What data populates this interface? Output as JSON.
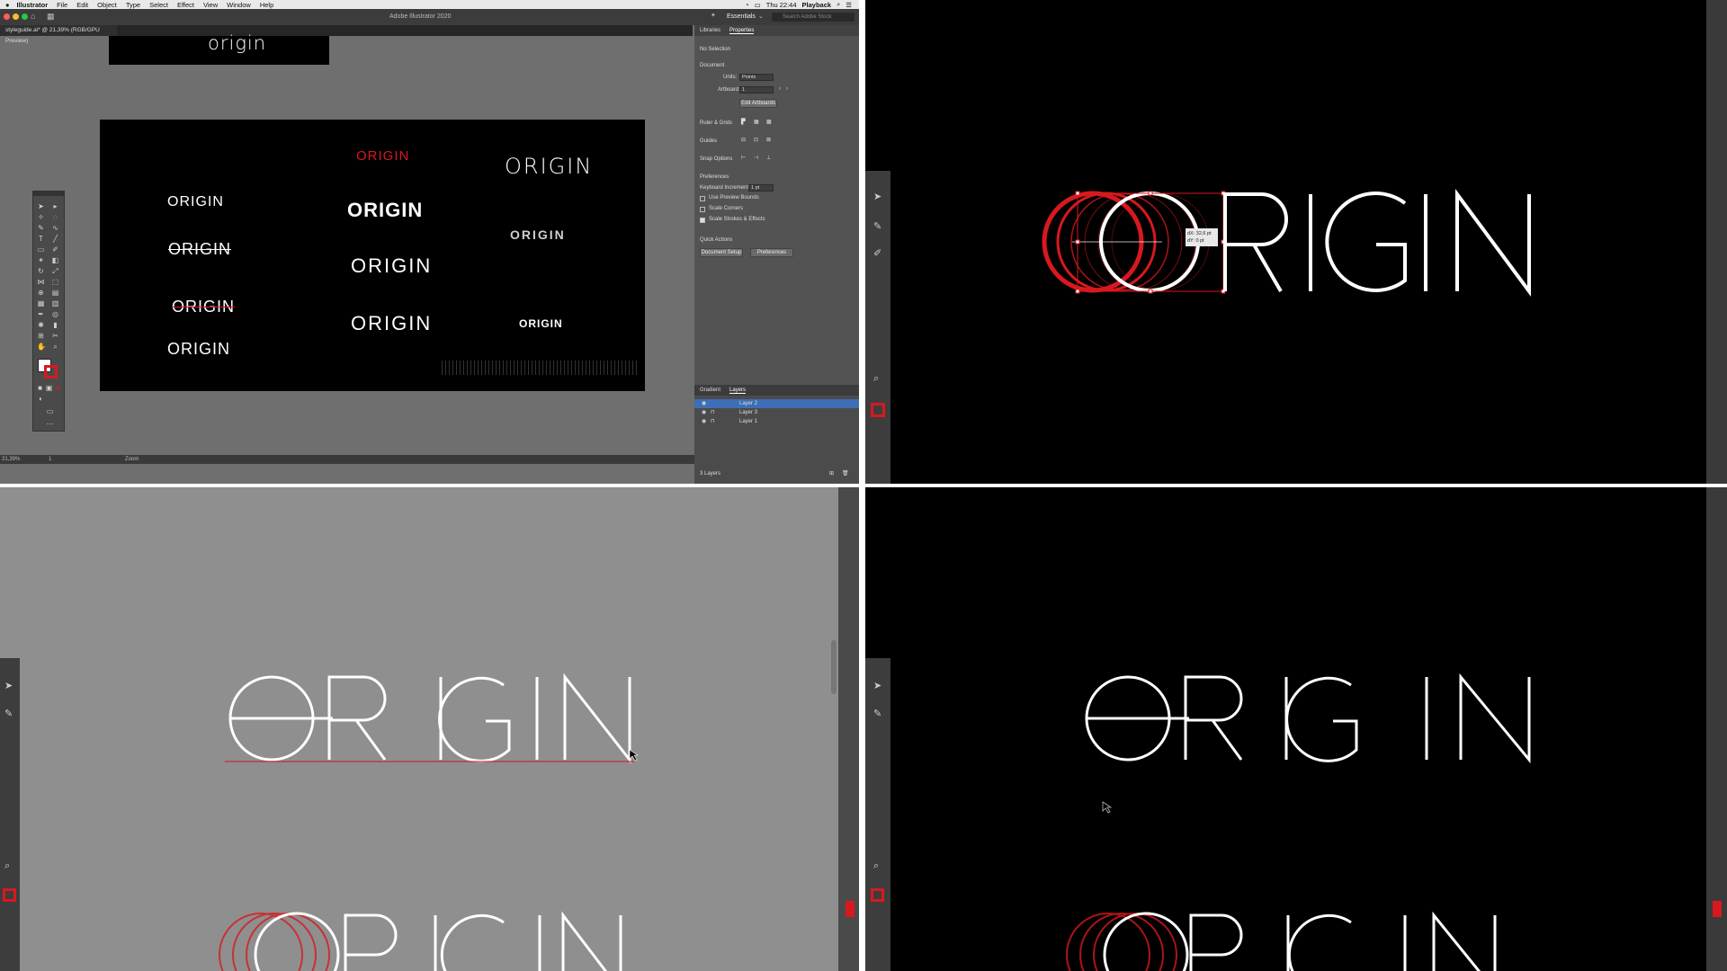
{
  "menubar": {
    "app": "Illustrator",
    "items": [
      "File",
      "Edit",
      "Object",
      "Type",
      "Select",
      "Effect",
      "View",
      "Window",
      "Help"
    ],
    "clock": "Thu 22:44",
    "user": "Playback"
  },
  "titlebar": {
    "title": "Adobe Illustrator 2020",
    "workspace": "Essentials",
    "search_placeholder": "Search Adobe Stock"
  },
  "document_tab": "styleguide.ai* @ 21,39% (RGB/GPU Preview)",
  "panel": {
    "tabs": [
      "Libraries",
      "Properties"
    ],
    "no_selection": "No Selection",
    "document_label": "Document",
    "units_label": "Units:",
    "units_value": "Points",
    "artboard_label": "Artboard:",
    "artboard_value": "1",
    "edit_artboards": "Edit Artboards",
    "ruler_grids": "Ruler & Grids",
    "guides": "Guides",
    "snap_options": "Snap Options",
    "preferences_label": "Preferences",
    "keyboard_increment_label": "Keyboard Increment:",
    "keyboard_increment_value": "1 pt",
    "use_preview_bounds": "Use Preview Bounds",
    "scale_corners": "Scale Corners",
    "scale_strokes": "Scale Strokes & Effects",
    "quick_actions": "Quick Actions",
    "document_setup": "Document Setup",
    "preferences_button": "Preferences"
  },
  "layers_panel": {
    "tabs": [
      "Gradient",
      "Layers"
    ],
    "layers": [
      "Layer 2",
      "Layer 3",
      "Layer 1"
    ],
    "count": "3 Layers"
  },
  "statusbar": {
    "zoom": "21,39%",
    "artboard": "1",
    "tool": "Zoom"
  },
  "artboard_logos": {
    "top": "origin",
    "items": [
      "ORIGIN",
      "ORIGIN",
      "ORIGIN",
      "ORIGIN",
      "ORIGIN",
      "ORIGIN",
      "ORIGIN",
      "ORIGIN",
      "ORIGIN",
      "ORIGIN",
      "ORIGIN"
    ]
  },
  "tooltip": {
    "dx": "dX: 32,6 pt",
    "dy": "dY: 0 pt"
  },
  "logo_word": "RIGIN",
  "colors": {
    "accent_red": "#d7191f",
    "pasteboard_q1": "#6f6f6f",
    "pasteboard_q3": "#8f8f8f",
    "selection_blue": "#3d6fb6"
  }
}
